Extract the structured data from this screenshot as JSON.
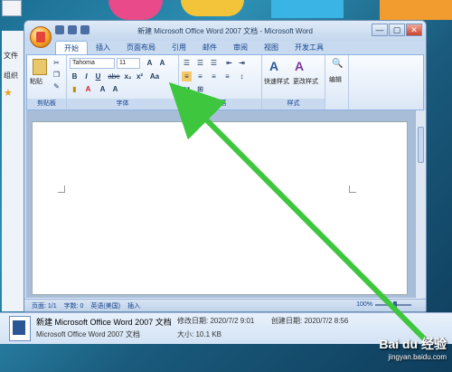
{
  "window": {
    "title": "新建 Microsoft Office Word 2007 文档 - Microsoft Word",
    "controls": [
      "—",
      "▢",
      "✕"
    ]
  },
  "explorer": {
    "labels": [
      "文件",
      "组织"
    ]
  },
  "tabs": [
    "开始",
    "插入",
    "页面布局",
    "引用",
    "邮件",
    "审阅",
    "视图",
    "开发工具"
  ],
  "ribbon": {
    "clipboard": {
      "paste": "粘贴",
      "label": "剪贴板"
    },
    "font": {
      "font_name": "Tahoma",
      "font_size": "11",
      "label": "字体",
      "buttons": [
        "B",
        "I",
        "U",
        "abe",
        "x₂",
        "x²",
        "Aa",
        "A",
        "A",
        "A"
      ]
    },
    "paragraph": {
      "label": "段落"
    },
    "styles": {
      "quick": "快速样式",
      "change": "更改样式",
      "label": "样式"
    },
    "editing": {
      "label": "编辑"
    }
  },
  "statusbar": {
    "page": "页面: 1/1",
    "words": "字数: 0",
    "language": "英语(美国)",
    "mode": "插入",
    "zoom": "100%"
  },
  "details": {
    "name": "新建 Microsoft Office Word 2007 文档",
    "modified_label": "修改日期: 2020/7/2 9:01",
    "created_label": "创建日期: 2020/7/2 8:56",
    "type": "Microsoft Office Word 2007 文档",
    "size": "大小: 10.1 KB"
  },
  "watermark": {
    "brand": "Bai du 经验",
    "url": "jingyan.baidu.com"
  },
  "colors": {
    "arrow": "#3ec63e",
    "ribbon_bg": "#dbe7f6",
    "window_frame": "#c7daf0"
  }
}
